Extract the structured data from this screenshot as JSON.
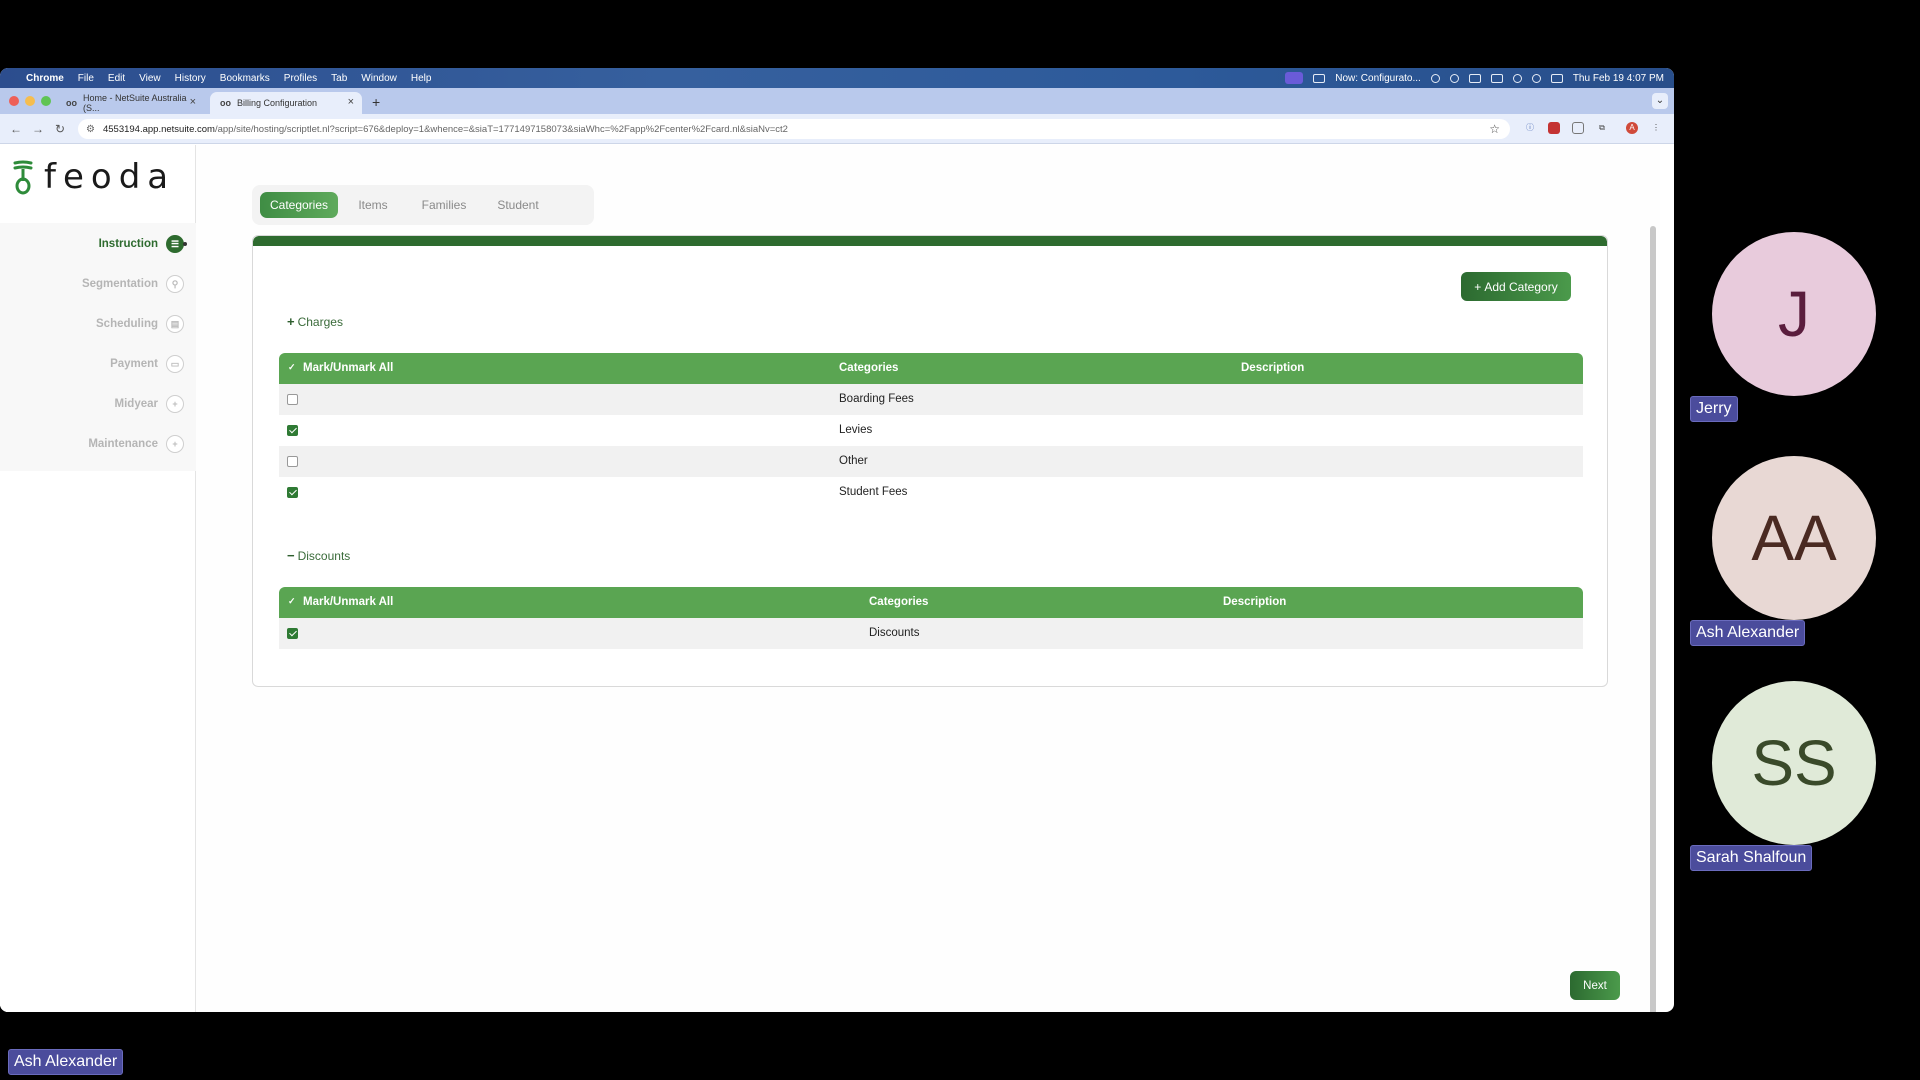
{
  "menubar": {
    "apple": "",
    "items": [
      "Chrome",
      "File",
      "Edit",
      "View",
      "History",
      "Bookmarks",
      "Profiles",
      "Tab",
      "Window",
      "Help"
    ],
    "status_text": "Now: Configurato...",
    "datetime": "Thu Feb 19  4:07 PM"
  },
  "browser": {
    "tabs": [
      {
        "favicon": "oo",
        "title": "Home - NetSuite Australia (S..."
      },
      {
        "favicon": "oo",
        "title": "Billing Configuration"
      }
    ],
    "url_host": "4553194.app.netsuite.com",
    "url_path": "/app/site/hosting/scriptlet.nl?script=676&deploy=1&whence=&siaT=1771497158073&siaWhc=%2Fapp%2Fcenter%2Fcard.nl&siaNv=ct2",
    "profile_initial": "A"
  },
  "app": {
    "logo_text": "feoda",
    "nav": [
      {
        "label": "Instruction",
        "icon": "list-icon",
        "active": true
      },
      {
        "label": "Segmentation",
        "icon": "person-icon",
        "active": false
      },
      {
        "label": "Scheduling",
        "icon": "calendar-icon",
        "active": false
      },
      {
        "label": "Payment",
        "icon": "card-icon",
        "active": false
      },
      {
        "label": "Midyear",
        "icon": "plus-circle-icon",
        "active": false
      },
      {
        "label": "Maintenance",
        "icon": "plus-circle-icon",
        "active": false
      }
    ],
    "tabs": [
      "Categories",
      "Items",
      "Families",
      "Student"
    ],
    "active_tab": "Categories",
    "add_category_label": "Add Category",
    "charges": {
      "toggle_symbol": "+",
      "label": "Charges",
      "headers": [
        "Mark/Unmark All",
        "Categories",
        "Description"
      ],
      "rows": [
        {
          "checked": false,
          "category": "Boarding Fees",
          "description": ""
        },
        {
          "checked": true,
          "category": "Levies",
          "description": ""
        },
        {
          "checked": false,
          "category": "Other",
          "description": ""
        },
        {
          "checked": true,
          "category": "Student Fees",
          "description": ""
        }
      ]
    },
    "discounts": {
      "toggle_symbol": "−",
      "label": "Discounts",
      "headers": [
        "Mark/Unmark All",
        "Categories",
        "Description"
      ],
      "rows": [
        {
          "checked": true,
          "category": "Discounts",
          "description": ""
        }
      ]
    },
    "next_label": "Next",
    "accent_color": "#2e6b2f"
  },
  "participants": [
    {
      "initials": "J",
      "name": "Jerry",
      "bg": "#e8cbdc",
      "fg": "#5a1d3d"
    },
    {
      "initials": "AA",
      "name": "Ash Alexander",
      "bg": "#e8d8d4",
      "fg": "#4a2a22"
    },
    {
      "initials": "SS",
      "name": "Sarah Shalfoun",
      "bg": "#e0ead8",
      "fg": "#3a4a2a"
    }
  ],
  "self_label": "Ash Alexander"
}
